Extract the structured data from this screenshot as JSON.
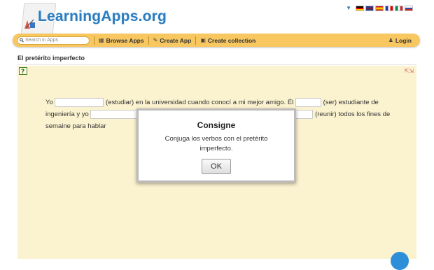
{
  "logo": {
    "text": "LearningApps.org"
  },
  "flags": [
    "de",
    "en",
    "es",
    "fr",
    "it",
    "ru"
  ],
  "nav": {
    "search_placeholder": "Search in Apps",
    "browse_label": "Browse Apps",
    "create_label": "Create App",
    "collection_label": "Create collection",
    "login_label": "Login"
  },
  "app": {
    "title": "El pretérito imperfecto",
    "text": {
      "t1": "Yo",
      "t2": "(estudiar) en la universidad cuando conocí a mi mejor amigo. Él",
      "t3": "(ser) estudiante de ingeniería y yo",
      "t4": "(reunir) todos los fines de semaine para hablar"
    }
  },
  "modal": {
    "title": "Consigne",
    "text": "Conjuga los verbos con el pretérito imperfecto.",
    "ok_label": "OK"
  }
}
